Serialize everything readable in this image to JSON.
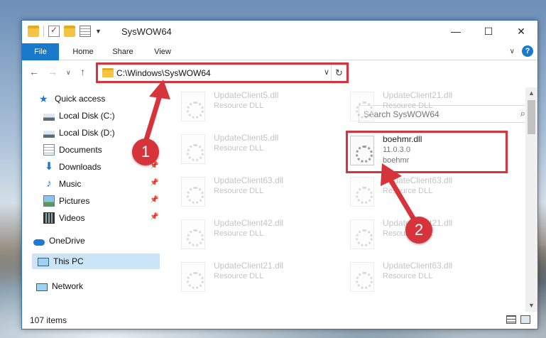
{
  "window": {
    "title": "SysWOW64",
    "controls": {
      "minimize": "—",
      "maximize": "☐",
      "close": "✕"
    }
  },
  "ribbon": {
    "tabs": [
      "File",
      "Home",
      "Share",
      "View"
    ],
    "expand_icon": "chevron-down-icon",
    "help_label": "?"
  },
  "address_bar": {
    "path": "C:\\Windows\\SysWOW64",
    "dropdown_glyph": "∨",
    "refresh_glyph": "↻"
  },
  "search": {
    "placeholder": "Search SysWOW64"
  },
  "nav_pane": {
    "items": [
      {
        "label": "Quick access",
        "icon": "star-icon",
        "pinned": false
      },
      {
        "label": "Local Disk (C:)",
        "icon": "drive-icon",
        "pinned": false
      },
      {
        "label": "Local Disk (D:)",
        "icon": "drive-icon",
        "pinned": false
      },
      {
        "label": "Documents",
        "icon": "documents-icon",
        "pinned": false
      },
      {
        "label": "Downloads",
        "icon": "download-icon",
        "pinned": true
      },
      {
        "label": "Music",
        "icon": "music-icon",
        "pinned": true
      },
      {
        "label": "Pictures",
        "icon": "pictures-icon",
        "pinned": true
      },
      {
        "label": "Videos",
        "icon": "videos-icon",
        "pinned": true
      },
      {
        "label": "OneDrive",
        "icon": "cloud-icon",
        "pinned": false
      },
      {
        "label": "This PC",
        "icon": "computer-icon",
        "pinned": false,
        "selected": true
      },
      {
        "label": "Network",
        "icon": "network-icon",
        "pinned": false
      }
    ]
  },
  "files": [
    {
      "name": "UpdateClient5.dll",
      "type": "Resource DLL",
      "highlight": false
    },
    {
      "name": "UpdateClient21.dll",
      "type": "Resource DLL",
      "highlight": false
    },
    {
      "name": "UpdateClient5.dll",
      "type": "Resource DLL",
      "highlight": false
    },
    {
      "name": "boehmr.dll",
      "version": "11.0.3.0",
      "type": "boehmr",
      "highlight": true
    },
    {
      "name": "UpdateClient63.dll",
      "type": "Resource DLL",
      "highlight": false
    },
    {
      "name": "UpdateClient63.dll",
      "type": "Resource DLL",
      "highlight": false
    },
    {
      "name": "UpdateClient42.dll",
      "type": "Resource DLL",
      "highlight": false
    },
    {
      "name": "UpdateClient21.dll",
      "type": "Resource DLL",
      "highlight": false
    },
    {
      "name": "UpdateClient21.dll",
      "type": "Resource DLL",
      "highlight": false
    },
    {
      "name": "UpdateClient63.dll",
      "type": "Resource DLL",
      "highlight": false
    }
  ],
  "status_bar": {
    "item_count": "107 items"
  },
  "annotations": {
    "badge1": "1",
    "badge2": "2",
    "color": "#d6333a"
  }
}
